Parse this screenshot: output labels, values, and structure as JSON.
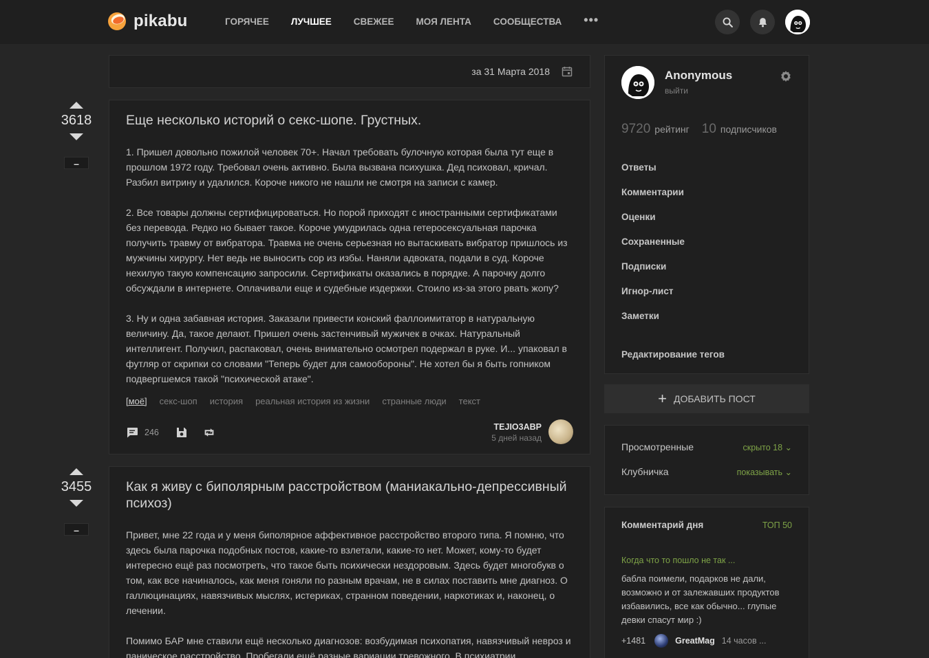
{
  "header": {
    "logo_text": "pikabu",
    "nav": [
      "ГОРЯЧЕЕ",
      "ЛУЧШЕЕ",
      "СВЕЖЕЕ",
      "МОЯ ЛЕНТА",
      "СООБЩЕСТВА"
    ],
    "active_nav": "ЛУЧШЕЕ",
    "more": "•••"
  },
  "datebar": {
    "text": "за 31 Марта 2018"
  },
  "stories": [
    {
      "rating": "3618",
      "minus": "–",
      "title": "Еще несколько историй о секс-шопе. Грустных.",
      "paragraphs": [
        "1. Пришел довольно пожилой человек 70+. Начал требовать булочную которая была тут еще в прошлом 1972 году. Требовал очень активно. Была вызвана психушка. Дед психовал, кричал. Разбил витрину и удалился. Короче никого не нашли не смотря на записи с камер.",
        "2. Все товары должны сертифицироваться. Но порой приходят с иностранными сертификатами без перевода. Редко но бывает такое. Короче умудрилась одна гетеросексуальная парочка получить травму от вибратора. Травма не очень серьезная но вытаскивать вибратор пришлось из мужчины хирургу. Нет ведь не выносить сор из избы. Наняли адвоката, подали в суд. Короче нехилую такую компенсацию запросили. Сертификаты оказались в порядке. А парочку долго обсуждали в интернете. Оплачивали еще и судебные издержки. Стоило из-за этого рвать жопу?",
        "3. Ну и одна забавная история. Заказали привести конский фаллоимитатор в натуральную величину. Да, такое делают. Пришел очень застенчивый мужичек в очках. Натуральный интеллигент. Получил, распаковал, очень внимательно осмотрел подержал в руке. И... упаковал в футляр от скрипки со словами \"Теперь будет для самообороны\". Не хотел бы я быть гопником подвергшемся такой \"психической атаке\"."
      ],
      "tags": [
        "[моё]",
        "секс-шоп",
        "история",
        "реальная история из жизни",
        "странные люди",
        "текст"
      ],
      "comments": "246",
      "author": "TEJIO3ABP",
      "time": "5 дней назад"
    },
    {
      "rating": "3455",
      "minus": "–",
      "title": "Как я живу с биполярным расстройством (маниакально-депрессивный психоз)",
      "paragraphs": [
        "Привет, мне 22 года и у меня биполярное аффективное расстройство второго типа. Я помню, что здесь была парочка подобных постов, какие-то взлетали, какие-то нет. Может, кому-то будет интересно ещё раз посмотреть, что такое быть психически нездоровым. Здесь будет многобукв о том, как все начиналось, как меня гоняли по разным врачам, не в силах поставить мне диагноз. О галлюцинациях, навязчивых мыслях, истериках, странном поведении, наркотиках и, наконец, о лечении.",
        "Помимо БАР мне ставили ещё несколько диагнозов: возбудимая психопатия, навязчивый невроз и паническое расстройство. Пробегали ещё разные вариации тревожного. В психиатрии"
      ]
    }
  ],
  "sidebar": {
    "profile": {
      "name": "Anonymous",
      "exit": "выйти",
      "rating": "9720",
      "rating_label": "рейтинг",
      "subs": "10",
      "subs_label": "подписчиков"
    },
    "menu": [
      "Ответы",
      "Комментарии",
      "Оценки",
      "Сохраненные",
      "Подписки",
      "Игнор-лист",
      "Заметки"
    ],
    "edit_tags": "Редактирование тегов",
    "add_post": "ДОБАВИТЬ ПОСТ",
    "filters": [
      {
        "label": "Просмотренные",
        "value": "скрыто 18 ⌄"
      },
      {
        "label": "Клубничка",
        "value": "показывать ⌄"
      }
    ],
    "comment_day": {
      "title": "Комментарий дня",
      "top": "ТОП 50",
      "link": "Когда что то пошло не так ...",
      "text": "бабла поимели, подарков не дали, возможно и от залежавших продуктов избавились, все как обычно... глупые девки спасут мир :)",
      "votes": "+1481",
      "user": "GreatMag",
      "time": "14 часов ..."
    }
  },
  "colors": {
    "accent_green": "#7ea347",
    "bg": "#262626",
    "panel": "#1f1f1f"
  }
}
